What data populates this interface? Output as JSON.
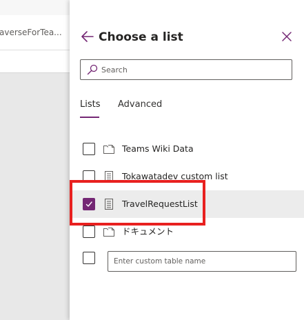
{
  "background": {
    "tab_text": "averseForTea..."
  },
  "panel": {
    "title": "Choose a list",
    "search_placeholder": "Search",
    "tabs": [
      {
        "label": "Lists",
        "active": true
      },
      {
        "label": "Advanced",
        "active": false
      }
    ],
    "items": [
      {
        "label": "Teams Wiki Data",
        "icon": "folder-doc-icon",
        "checked": false
      },
      {
        "label": "Tokawatadev custom list",
        "icon": "list-icon",
        "checked": false
      },
      {
        "label": "TravelRequestList",
        "icon": "list-icon",
        "checked": true
      },
      {
        "label": "ドキュメント",
        "icon": "folder-doc-icon",
        "checked": false
      }
    ],
    "custom_placeholder": "Enter custom table name"
  },
  "colors": {
    "accent": "#742774",
    "highlight": "#e8201f",
    "selected_row": "#ececec"
  }
}
